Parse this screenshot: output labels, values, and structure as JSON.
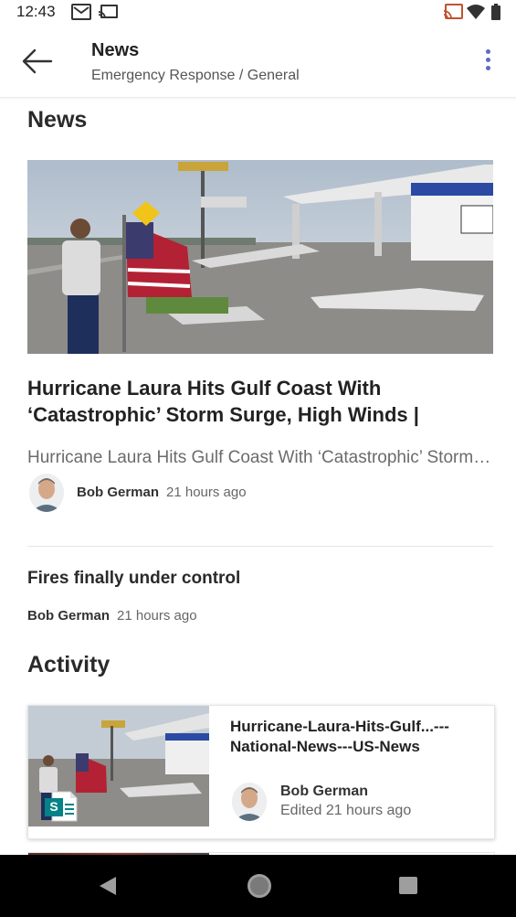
{
  "status_bar": {
    "time": "12:43"
  },
  "header": {
    "title": "News",
    "subtitle": "Emergency Response / General"
  },
  "news": {
    "section_title": "News",
    "featured": {
      "headline": "Hurricane Laura Hits Gulf Coast With ‘Catastrophic’ Storm Surge, High Winds | National News | US News",
      "description": "Hurricane Laura Hits Gulf Coast With ‘Catastrophic’ Storm Surge, High Winds",
      "author": "Bob German",
      "time": "21 hours ago"
    },
    "second": {
      "title": "Fires finally under control",
      "author": "Bob German",
      "time": "21 hours ago"
    }
  },
  "activity": {
    "section_title": "Activity",
    "items": [
      {
        "title": "Hurricane-Laura-Hits-Gulf...---National-News---US-News",
        "author": "Bob German",
        "meta": "Edited 21 hours ago",
        "file_icon": "sharepoint-page-icon",
        "file_icon_letter": "S"
      }
    ]
  },
  "colors": {
    "accent": "#5b6bc0",
    "sharepoint": "#038387"
  }
}
